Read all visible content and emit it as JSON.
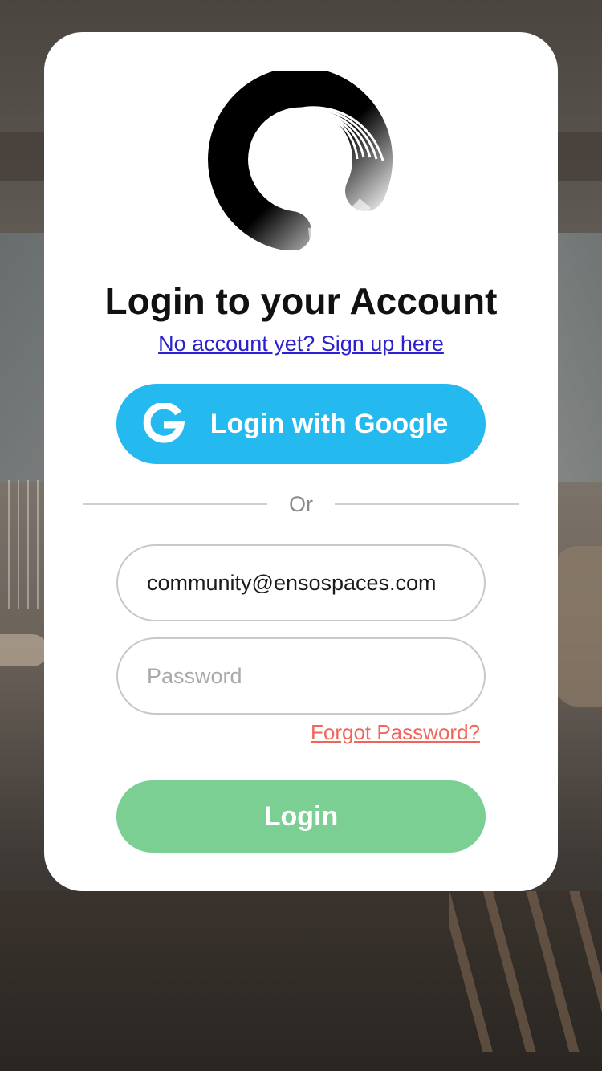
{
  "login": {
    "title": "Login to your Account",
    "signup_link": "No account yet? Sign up here",
    "google_button": "Login with Google",
    "divider": "Or",
    "email_value": "community@ensospaces.com",
    "password_placeholder": "Password",
    "forgot_link": "Forgot Password?",
    "login_button": "Login"
  },
  "icons": {
    "logo": "enso-circle-logo",
    "google": "google-g-icon"
  },
  "colors": {
    "google_button": "#24b9ef",
    "login_button": "#7bcf92",
    "signup_link": "#2b21cf",
    "forgot_link": "#f0655a"
  }
}
